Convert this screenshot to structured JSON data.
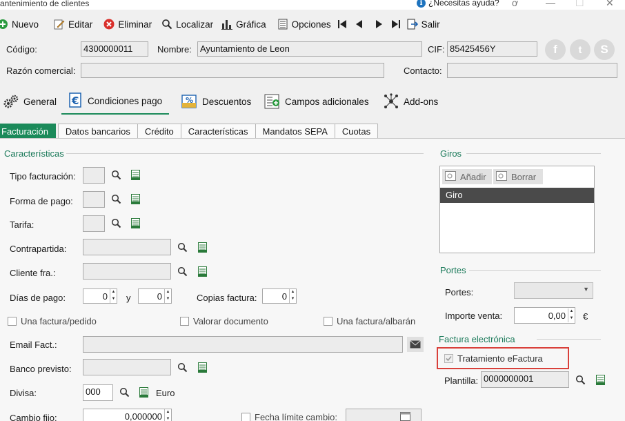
{
  "window": {
    "title": "antenimiento de clientes",
    "help": "¿Necesitas ayuda?",
    "help_suffix": "ơ",
    "minimize": "—",
    "maximize": "☐",
    "close": "✕"
  },
  "toolbar": {
    "nuevo": "Nuevo",
    "editar": "Editar",
    "eliminar": "Eliminar",
    "localizar": "Localizar",
    "grafica": "Gráfica",
    "opciones": "Opciones",
    "salir": "Salir"
  },
  "header": {
    "codigo_label": "Código:",
    "codigo_value": "4300000011",
    "nombre_label": "Nombre:",
    "nombre_value": "Ayuntamiento de Leon",
    "cif_label": "CIF:",
    "cif_value": "85425456Y",
    "razon_label": "Razón comercial:",
    "razon_value": "",
    "contacto_label": "Contacto:",
    "contacto_value": ""
  },
  "main_tabs": {
    "general": "General",
    "condiciones": "Condiciones pago",
    "descuentos": "Descuentos",
    "campos": "Campos adicionales",
    "addons": "Add-ons"
  },
  "sub_tabs": {
    "facturacion": "Facturación",
    "datos_bancarios": "Datos bancarios",
    "credito": "Crédito",
    "caracteristicas": "Características",
    "mandatos": "Mandatos SEPA",
    "cuotas": "Cuotas"
  },
  "caracteristicas": {
    "title": "Características",
    "tipo_facturacion": "Tipo facturación:",
    "forma_pago": "Forma de pago:",
    "tarifa": "Tarifa:",
    "contrapartida": "Contrapartida:",
    "cliente_fra": "Cliente fra.:",
    "dias_pago": "Días de pago:",
    "dias_pago_1": "0",
    "y": "y",
    "dias_pago_2": "0",
    "copias_factura": "Copias factura:",
    "copias_value": "0",
    "una_factura_pedido": "Una factura/pedido",
    "valorar_documento": "Valorar documento",
    "una_factura_albaran": "Una factura/albarán",
    "email_fact": "Email Fact.:",
    "banco_previsto": "Banco previsto:",
    "divisa": "Divisa:",
    "divisa_value": "000",
    "divisa_name": "Euro",
    "cambio_fijo": "Cambio fijo:",
    "cambio_value": "0,000000",
    "fecha_limite": "Fecha límite cambio:"
  },
  "giros": {
    "title": "Giros",
    "anadir": "Añadir",
    "borrar": "Borrar",
    "column": "Giro"
  },
  "portes": {
    "title": "Portes",
    "portes_label": "Portes:",
    "importe_label": "Importe venta:",
    "importe_value": "0,00",
    "currency": "€"
  },
  "factura_electronica": {
    "title": "Factura electrónica",
    "tratamiento": "Tratamiento eFactura",
    "plantilla_label": "Plantilla:",
    "plantilla_value": "0000000001"
  },
  "social": {
    "facebook": "f",
    "twitter": "t",
    "skype": "S"
  },
  "colors": {
    "accent": "#1b8a5a",
    "highlight": "#d9403a"
  }
}
